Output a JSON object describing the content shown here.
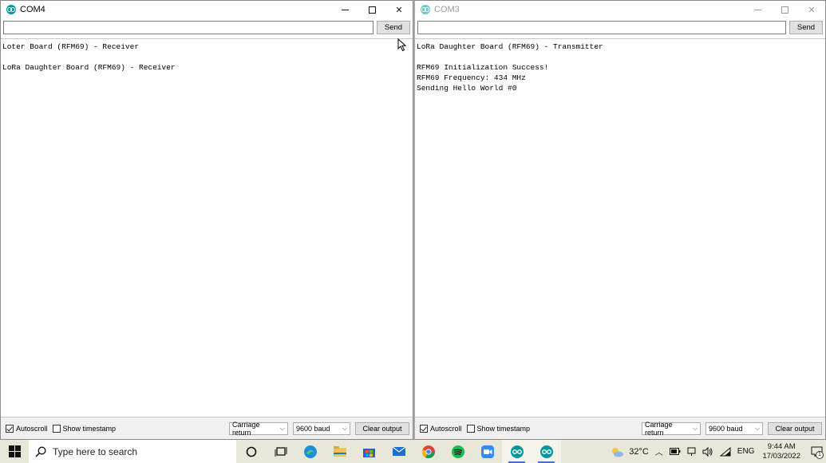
{
  "windows": {
    "left": {
      "title": "COM4",
      "send_label": "Send",
      "input_value": "",
      "output_lines": [
        "Loter Board (RFM69) - Receiver",
        "",
        "LoRa Daughter Board (RFM69) - Receiver"
      ],
      "autoscroll_label": "Autoscroll",
      "autoscroll_checked": true,
      "timestamp_label": "Show timestamp",
      "timestamp_checked": false,
      "line_ending": "Carriage return",
      "baud": "9600 baud",
      "clear_label": "Clear output"
    },
    "right": {
      "title": "COM3",
      "send_label": "Send",
      "input_value": "",
      "output_lines": [
        "LoRa Daughter Board (RFM69) - Transmitter",
        "",
        "RFM69 Initialization Success!",
        "RFM69 Frequency: 434 MHz",
        "Sending Hello World #0"
      ],
      "autoscroll_label": "Autoscroll",
      "autoscroll_checked": true,
      "timestamp_label": "Show timestamp",
      "timestamp_checked": false,
      "line_ending": "Carriage return",
      "baud": "9600 baud",
      "clear_label": "Clear output"
    }
  },
  "taskbar": {
    "search_placeholder": "Type here to search",
    "weather_temp": "32°C",
    "language": "ENG",
    "time": "9:44 AM",
    "date": "17/03/2022",
    "notification_count": "1",
    "apps": [
      "cortana-icon",
      "task-view-icon",
      "edge-icon",
      "file-explorer-icon",
      "store-icon",
      "mail-icon",
      "chrome-icon",
      "spotify-icon",
      "zoom-icon",
      "arduino-icon",
      "arduino-icon"
    ]
  },
  "colors": {
    "arduino_teal": "#00979c",
    "taskbar_bg": "#e8e8d8",
    "active_indicator": "#3a7bd5"
  }
}
